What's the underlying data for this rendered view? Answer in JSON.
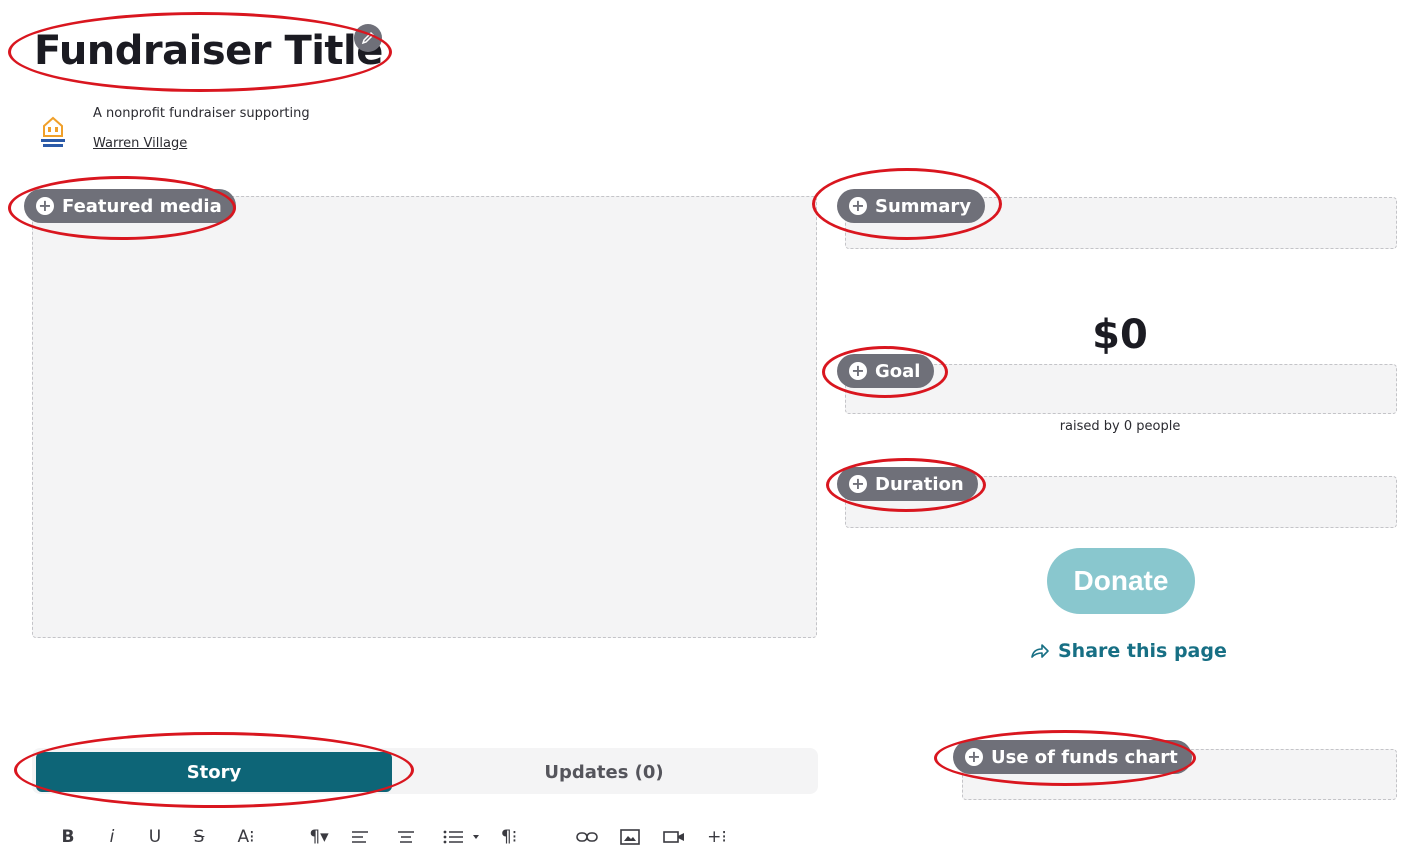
{
  "header": {
    "title": "Fundraiser Title"
  },
  "org": {
    "prefix": "A nonprofit fundraiser supporting",
    "name": "Warren Village",
    "logo_text": "Warren Village",
    "logo_color": "#f0a02a"
  },
  "sections": {
    "featured_media": "Featured media",
    "summary": "Summary",
    "goal": "Goal",
    "duration": "Duration",
    "use_of_funds": "Use of funds chart"
  },
  "goal": {
    "amount": "$0",
    "raised_text": "raised by 0 people"
  },
  "actions": {
    "donate": "Donate",
    "share": "Share this page"
  },
  "tabs": [
    {
      "label": "Story",
      "active": true
    },
    {
      "label": "Updates (0)",
      "active": false
    }
  ],
  "toolbar": {
    "bold": "B",
    "italic": "i",
    "underline": "U",
    "strike": "S",
    "font_size": "A⁝",
    "paragraph": "¶▾",
    "align": "☰",
    "clear": "¶⁝",
    "insert_more": "+⁝"
  },
  "colors": {
    "accent": "#0d6577",
    "donate": "#89c7ce",
    "pill": "#6f7079",
    "annotation": "#d9161f",
    "link": "#176f84"
  }
}
